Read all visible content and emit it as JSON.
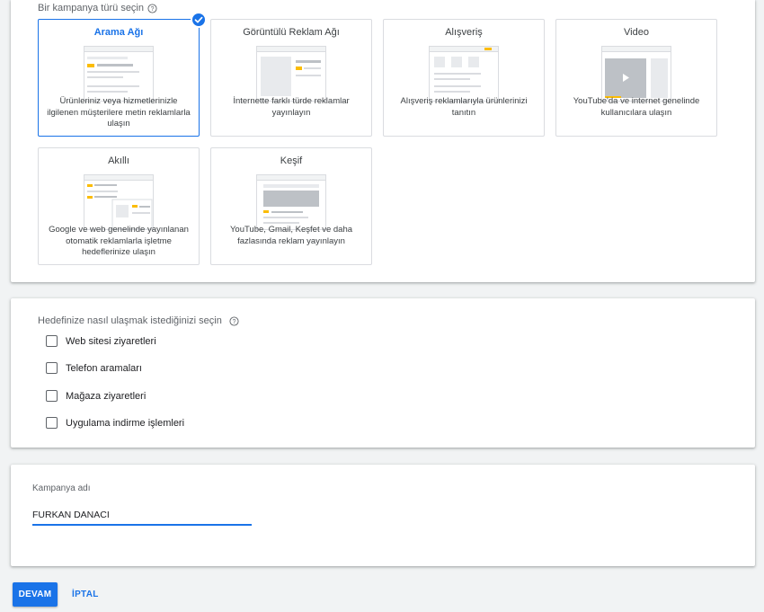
{
  "campaign_type": {
    "label": "Bir kampanya türü seçin",
    "cards": [
      {
        "title": "Arama Ağı",
        "description": "Ürünleriniz veya hizmetlerinizle ilgilenen müşterilere metin reklamlarla ulaşın",
        "selected": true
      },
      {
        "title": "Görüntülü Reklam Ağı",
        "description": "İnternette farklı türde reklamlar yayınlayın",
        "selected": false
      },
      {
        "title": "Alışveriş",
        "description": "Alışveriş reklamlarıyla ürünlerinizi tanıtın",
        "selected": false
      },
      {
        "title": "Video",
        "description": "YouTube'da ve internet genelinde kullanıcılara ulaşın",
        "selected": false
      },
      {
        "title": "Akıllı",
        "description": "Google ve web genelinde yayınlanan otomatik reklamlarla işletme hedeflerinize ulaşın",
        "selected": false
      },
      {
        "title": "Keşif",
        "description": "YouTube, Gmail, Keşfet ve daha fazlasında reklam yayınlayın",
        "selected": false
      }
    ]
  },
  "goals": {
    "label": "Hedefinize nasıl ulaşmak istediğinizi seçin",
    "options": [
      {
        "label": "Web sitesi ziyaretleri",
        "checked": false
      },
      {
        "label": "Telefon aramaları",
        "checked": false
      },
      {
        "label": "Mağaza ziyaretleri",
        "checked": false
      },
      {
        "label": "Uygulama indirme işlemleri",
        "checked": false
      }
    ]
  },
  "campaign_name": {
    "label": "Kampanya adı",
    "value": "FURKAN DANACI"
  },
  "actions": {
    "continue": "DEVAM",
    "cancel": "İPTAL"
  },
  "colors": {
    "accent": "#1a73e8",
    "highlight": "#fbbc04"
  }
}
